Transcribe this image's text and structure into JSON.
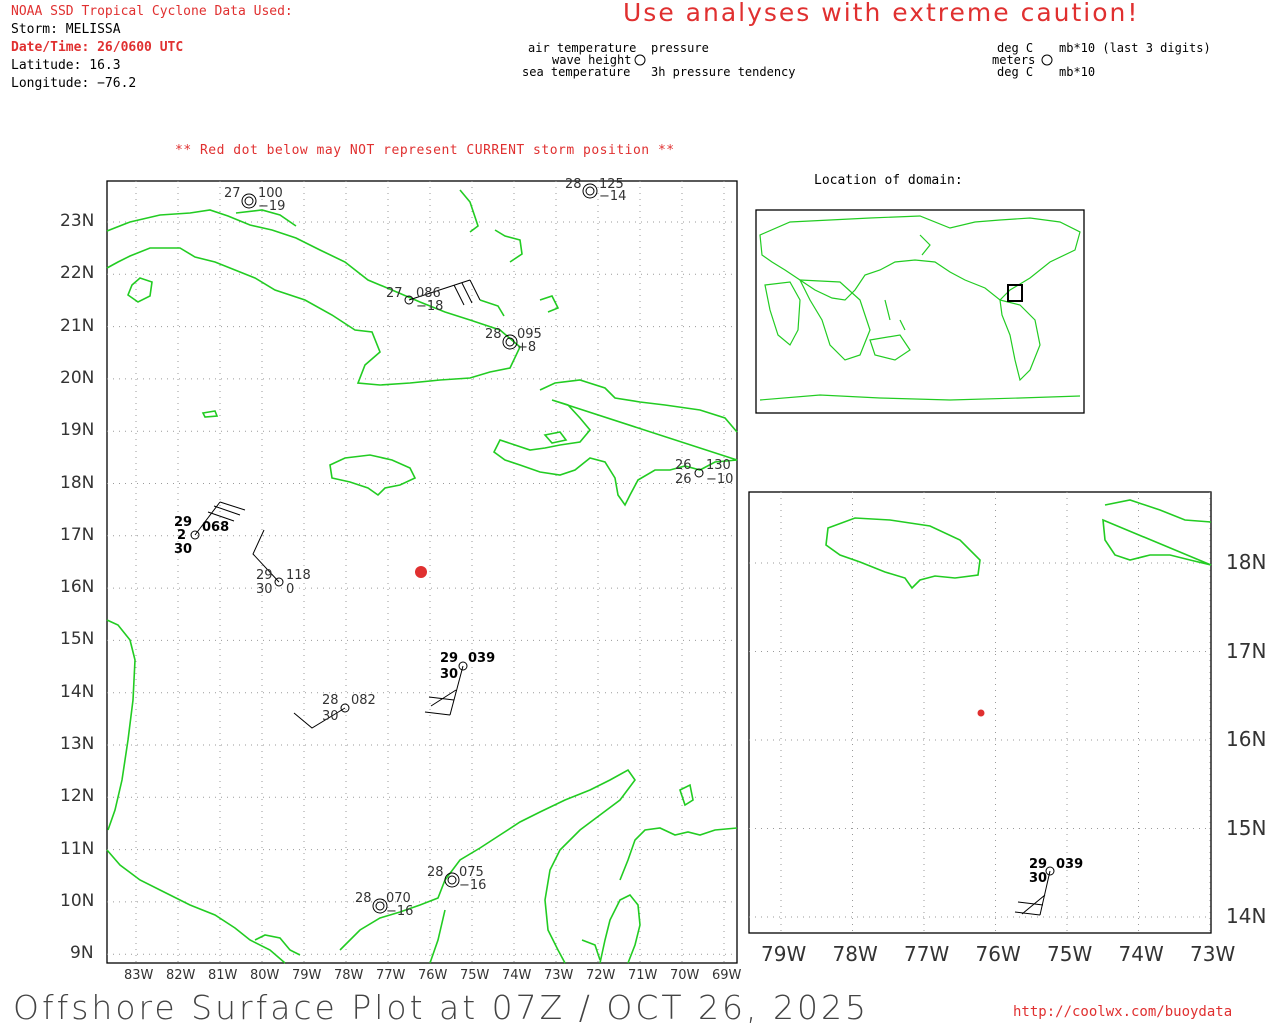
{
  "header": {
    "source": "NOAA SSD Tropical Cyclone Data Used:",
    "storm": "Storm: MELISSA",
    "datetime": "Date/Time: 26/0600 UTC",
    "latitude": "Latitude: 16.3",
    "longitude": "Longitude: −76.2"
  },
  "caution": "Use analyses with extreme caution!",
  "legend": {
    "left": {
      "air_temp": "air temperature",
      "pressure": "pressure",
      "wave_height": "wave height",
      "sea_temp": "sea temperature",
      "tendency": "3h pressure tendency"
    },
    "right": {
      "deg_c_top": "deg C",
      "mb10_last3": "mb*10 (last 3 digits)",
      "meters": "meters",
      "deg_c_bottom": "deg C",
      "mb10": "mb*10"
    }
  },
  "warning": "** Red dot below may NOT represent CURRENT storm position **",
  "location_label": "Location of domain:",
  "main_map": {
    "lat_labels": [
      "23N",
      "22N",
      "21N",
      "20N",
      "19N",
      "18N",
      "17N",
      "16N",
      "15N",
      "14N",
      "13N",
      "12N",
      "11N",
      "10N",
      "9N"
    ],
    "lon_labels": [
      "83W",
      "82W",
      "81W",
      "80W",
      "79W",
      "78W",
      "77W",
      "76W",
      "75W",
      "74W",
      "73W",
      "72W",
      "71W",
      "70W",
      "69W"
    ],
    "storm_position": {
      "lat": 16.3,
      "lon": -76.2
    },
    "stations": [
      {
        "lat": 23.4,
        "lon": -80.3,
        "air_temp": "27",
        "pressure": "100",
        "tendency": "−19",
        "symbol": "wave"
      },
      {
        "lat": 23.6,
        "lon": -72.3,
        "air_temp": "28",
        "pressure": "125",
        "tendency": "−14",
        "symbol": "wave"
      },
      {
        "lat": 21.5,
        "lon": -75.6,
        "air_temp": "27",
        "pressure": "086",
        "tendency": "−18",
        "symbol": "circle"
      },
      {
        "lat": 20.7,
        "lon": -74.1,
        "air_temp": "28",
        "pressure": "095",
        "tendency": "+8",
        "symbol": "wave"
      },
      {
        "lat": 18.2,
        "lon": -69.6,
        "air_temp": "26",
        "pressure": "130",
        "sea_temp": "26",
        "tendency": "−10",
        "symbol": "circle"
      },
      {
        "lat": 17.0,
        "lon": -81.7,
        "air_temp": "29",
        "pressure": "068",
        "wave": "2",
        "sea_temp": "30",
        "symbol": "circle",
        "bold": true
      },
      {
        "lat": 16.1,
        "lon": -79.4,
        "air_temp": "29",
        "pressure": "118",
        "sea_temp": "30",
        "tendency": "0",
        "symbol": "circle"
      },
      {
        "lat": 14.5,
        "lon": -75.2,
        "air_temp": "29",
        "pressure": "039",
        "sea_temp": "30",
        "symbol": "circle",
        "bold": true
      },
      {
        "lat": 13.7,
        "lon": -78.0,
        "air_temp": "28",
        "pressure": "082",
        "sea_temp": "30",
        "symbol": "circle"
      },
      {
        "lat": 10.4,
        "lon": -75.5,
        "air_temp": "28",
        "pressure": "075",
        "tendency": "−16",
        "symbol": "wave"
      },
      {
        "lat": 9.9,
        "lon": -77.2,
        "air_temp": "28",
        "pressure": "070",
        "tendency": "−16",
        "symbol": "wave"
      }
    ]
  },
  "zoom_map": {
    "lat_labels": [
      "18N",
      "17N",
      "16N",
      "15N",
      "14N"
    ],
    "lon_labels": [
      "79W",
      "78W",
      "77W",
      "76W",
      "75W",
      "74W",
      "73W"
    ],
    "storm_position": {
      "lat": 16.3,
      "lon": -76.2
    },
    "station": {
      "air_temp": "29",
      "pressure": "039",
      "sea_temp": "30"
    }
  },
  "footer": {
    "title": "Offshore Surface Plot at 07Z / OCT 26, 2025",
    "url": "http://coolwx.com/buoydata"
  },
  "colors": {
    "coast": "#22cc22",
    "red": "#e03030",
    "grid": "#9a9a9a"
  }
}
